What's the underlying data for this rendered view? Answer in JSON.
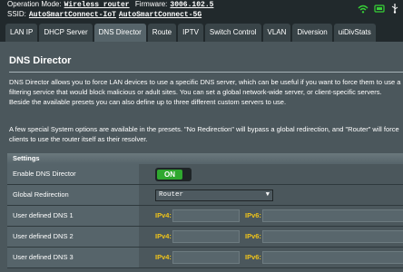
{
  "header": {
    "op_mode_label": "Operation Mode:",
    "op_mode_value": "Wireless router",
    "firmware_label": "Firmware:",
    "firmware_value": "3006.102.5",
    "ssid_label": "SSID:",
    "ssid_1": "AutoSmartConnect-IoT",
    "ssid_2": "AutoSmartConnect-5G",
    "icons": [
      "wifi-icon",
      "link-icon",
      "usb-icon"
    ]
  },
  "tabs": [
    {
      "label": "LAN IP"
    },
    {
      "label": "DHCP Server"
    },
    {
      "label": "DNS Director"
    },
    {
      "label": "Route"
    },
    {
      "label": "IPTV"
    },
    {
      "label": "Switch Control"
    },
    {
      "label": "VLAN"
    },
    {
      "label": "Diversion"
    },
    {
      "label": "uiDivStats"
    }
  ],
  "active_tab": "DNS Director",
  "page": {
    "title": "DNS Director",
    "description_1": "DNS Director allows you to force LAN devices to use a specific DNS server, which can be useful if you want to force them to use a filtering service that would block malicious or adult sites. You can set a global network-wide server, or client-specific servers. Beside the available presets you can also define up to three different custom servers to use.",
    "description_2": "A few special System options are available in the presets. \"No Redirection\" will bypass a global redirection, and \"Router\" will force clients to use the router itself as their resolver."
  },
  "settings": {
    "heading": "Settings",
    "enable_label": "Enable DNS Director",
    "enable_state": "ON",
    "global_label": "Global Redirection",
    "global_value": "Router",
    "dns_rows": [
      {
        "label": "User defined DNS 1",
        "ipv4_label": "IPv4:",
        "ipv4_value": "",
        "ipv6_label": "IPv6:",
        "ipv6_value": ""
      },
      {
        "label": "User defined DNS 2",
        "ipv4_label": "IPv4:",
        "ipv4_value": "",
        "ipv6_label": "IPv6:",
        "ipv6_value": ""
      },
      {
        "label": "User defined DNS 3",
        "ipv4_label": "IPv4:",
        "ipv4_value": "",
        "ipv6_label": "IPv6:",
        "ipv6_value": ""
      }
    ]
  },
  "colors": {
    "accent_on": "#2fa82f",
    "ip_label": "#f0c419",
    "background": "#21292c",
    "panel": "#4b575c"
  }
}
